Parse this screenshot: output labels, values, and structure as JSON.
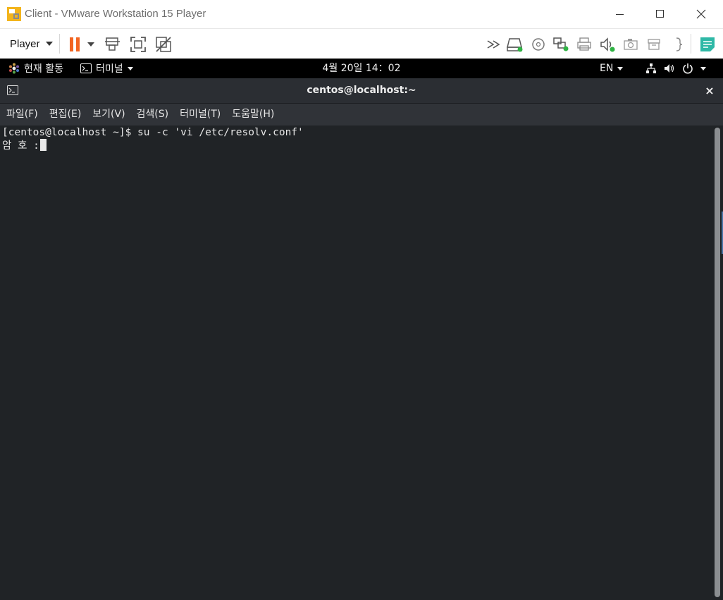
{
  "window": {
    "title": "Client - VMware Workstation 15 Player",
    "controls": {
      "minimize": "minimize-icon",
      "maximize": "maximize-icon",
      "close": "close-icon"
    }
  },
  "toolbar": {
    "player_label": "Player",
    "left_icons": [
      "pause-icon",
      "send-ctrl-alt-del-icon",
      "fullscreen-icon",
      "unity-icon"
    ],
    "right_icons": [
      "more-devices-icon",
      "hard-disk-icon",
      "cd-dvd-icon",
      "network-adapter-icon",
      "printer-icon",
      "sound-card-icon",
      "camera-icon",
      "removable-device-icon",
      "display-icon",
      "message-log-icon"
    ]
  },
  "gnome": {
    "activities_label": "현재 활동",
    "app_menu_label": "터미널",
    "clock": "4월 20일  14：02",
    "language": "EN"
  },
  "terminal": {
    "title": "centos@localhost:~",
    "close_glyph": "×",
    "menu": [
      "파일(F)",
      "편집(E)",
      "보기(V)",
      "검색(S)",
      "터미널(T)",
      "도움말(H)"
    ],
    "lines": [
      "[centos@localhost ~]$ su -c 'vi /etc/resolv.conf'",
      "암 호 :"
    ]
  },
  "colors": {
    "pause_accent": "#f26522",
    "status_green": "#2fb344",
    "notes_teal": "#2eb8a6",
    "terminal_bg": "#202326",
    "terminal_fg": "#e8e8e8"
  }
}
